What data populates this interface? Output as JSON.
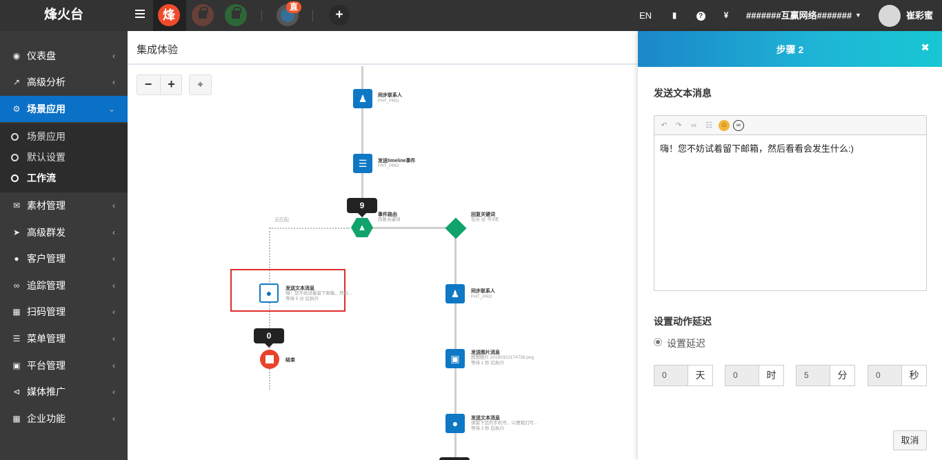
{
  "topbar": {
    "logo": "烽火台",
    "app1_char": "烽",
    "live_badge": "直",
    "lang": "EN",
    "org": "#######互赢网络#######",
    "user": "崔彩蜜"
  },
  "sidebar": {
    "items": [
      {
        "label": "仪表盘",
        "icon": "dashboard-icon"
      },
      {
        "label": "高级分析",
        "icon": "line-chart-icon"
      },
      {
        "label": "场景应用",
        "icon": "gear-icon"
      },
      {
        "label": "素材管理",
        "icon": "envelope-icon"
      },
      {
        "label": "高级群发",
        "icon": "paper-plane-icon"
      },
      {
        "label": "客户管理",
        "icon": "user-icon"
      },
      {
        "label": "追踪管理",
        "icon": "link-icon"
      },
      {
        "label": "扫码管理",
        "icon": "qrcode-icon"
      },
      {
        "label": "菜单管理",
        "icon": "list-icon"
      },
      {
        "label": "平台管理",
        "icon": "desktop-icon"
      },
      {
        "label": "媒体推广",
        "icon": "share-icon"
      },
      {
        "label": "企业功能",
        "icon": "grid-icon"
      }
    ],
    "submenu": [
      "场景应用",
      "默认设置",
      "工作流"
    ]
  },
  "main": {
    "title": "集成体验"
  },
  "flow": {
    "nodes": {
      "sync1_title": "同步联系人",
      "sync1_sub": "FHT_PRO",
      "timeline_title": "发送timeline事件",
      "timeline_sub": "FHT_PRO",
      "router_title": "事件路由",
      "router_sub": "回复关键词",
      "keyword_title": "回复关键词",
      "keyword_sub": "包含 @ 号3项",
      "nomatch_label": "无匹配",
      "text_title": "发送文本消息",
      "text_sub1": "嗨！您不妨试着留下邮箱，然后...",
      "text_sub2": "等待 5 分 后执行",
      "end_title": "结束",
      "sync2_title": "同步联系人",
      "sync2_sub": "FHT_PRO",
      "image_title": "发送图片消息",
      "image_sub1": "图图图片 20190322174738.png",
      "image_sub2": "等待 1 秒 后执行",
      "text2_title": "发送文本消息",
      "text2_sub1": "请留下您的手机号，以便我们可...",
      "text2_sub2": "等待 3 秒 后执行"
    },
    "router_count": "9",
    "end_count": "0"
  },
  "panel": {
    "title": "步骤 2",
    "section1": "发送文本消息",
    "editor_text": "嗨！您不妨试着留下邮箱，然后看看会发生什么:)",
    "section2": "设置动作延迟",
    "radio_label": "设置延迟",
    "delay": [
      {
        "value": "0",
        "unit": "天"
      },
      {
        "value": "0",
        "unit": "时"
      },
      {
        "value": "5",
        "unit": "分"
      },
      {
        "value": "0",
        "unit": "秒"
      }
    ],
    "cancel": "取消"
  },
  "colors": {
    "topbar": "#333333",
    "sidebar": "#3a3a3a",
    "active": "#0b71c6",
    "node_blue": "#0e78c4",
    "node_green": "#10a36b",
    "stop_red": "#e8432b",
    "highlight": "#e02a2a"
  }
}
